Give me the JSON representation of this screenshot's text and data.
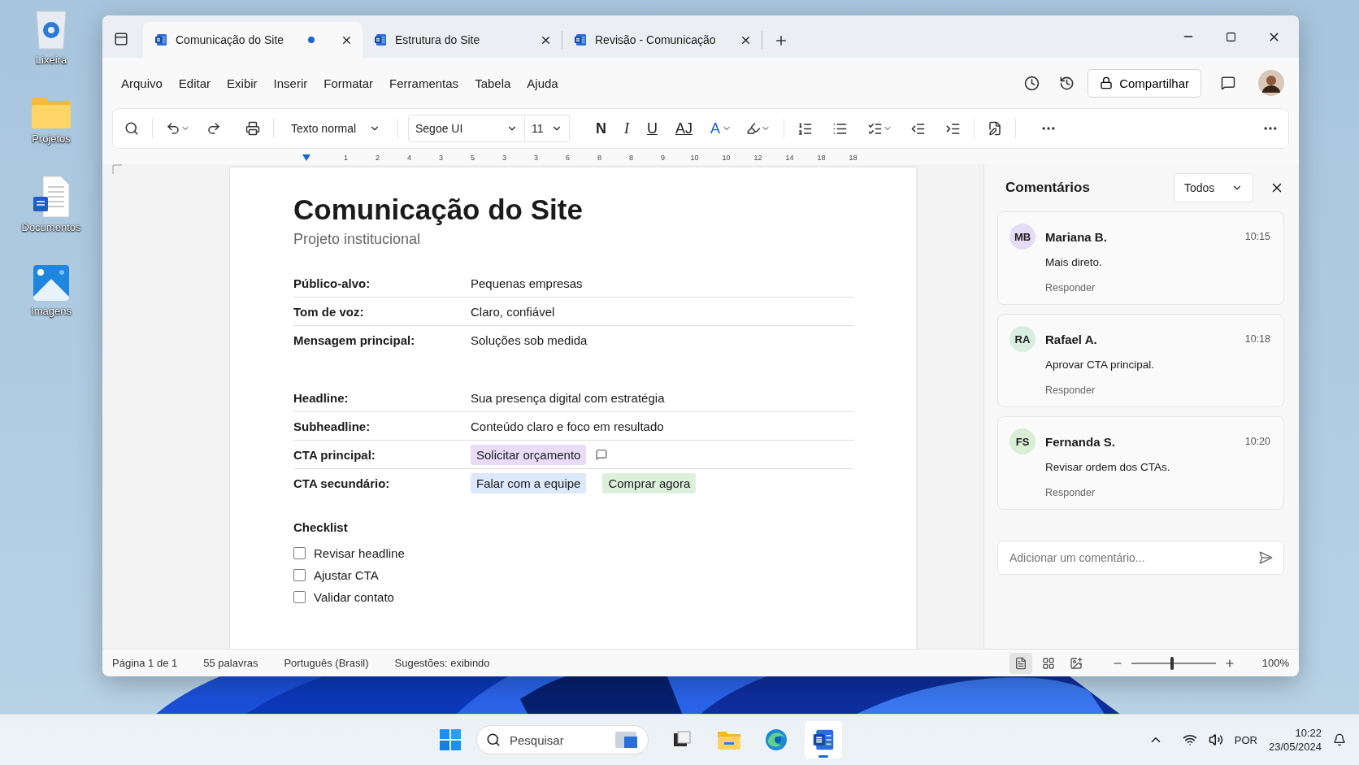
{
  "desktop_icons": [
    {
      "label": "Lixeira",
      "kind": "recycle"
    },
    {
      "label": "Projetos",
      "kind": "folder"
    },
    {
      "label": "Documentos",
      "kind": "document"
    },
    {
      "label": "Imagens",
      "kind": "images"
    }
  ],
  "tabs": [
    {
      "label": "Comunicação do Site",
      "selected": true,
      "unsaved": true
    },
    {
      "label": "Estrutura do Site",
      "selected": false,
      "unsaved": false
    },
    {
      "label": "Revisão - Comunicação",
      "selected": false,
      "unsaved": false
    }
  ],
  "menu": [
    "Arquivo",
    "Editar",
    "Exibir",
    "Inserir",
    "Formatar",
    "Ferramentas",
    "Tabela",
    "Ajuda"
  ],
  "share_button": "Compartilhar",
  "toolbar": {
    "style": "Texto normal",
    "font": "Segoe UI",
    "size": "11",
    "format_buttons": [
      "N",
      "I",
      "U",
      "AJ",
      "A"
    ]
  },
  "ruler": [
    "1",
    "2",
    "4",
    "3",
    "5",
    "3",
    "3",
    "6",
    "8",
    "8",
    "9",
    "10",
    "10",
    "12",
    "14",
    "18",
    "18"
  ],
  "document": {
    "title": "Comunicação do Site",
    "subtitle": "Projeto institucional",
    "field_groups": [
      [
        {
          "label": "Público-alvo:",
          "kind": "text",
          "value": "Pequenas empresas"
        },
        {
          "label": "Tom de voz:",
          "kind": "text",
          "value": "Claro, confiável"
        },
        {
          "label": "Mensagem principal:",
          "kind": "text",
          "value": "Soluções sob medida"
        }
      ],
      [
        {
          "label": "Headline:",
          "kind": "text",
          "value": "Sua presença digital com estratégia"
        },
        {
          "label": "Subheadline:",
          "kind": "text",
          "value": "Conteúdo claro e foco em resultado"
        },
        {
          "label": "CTA principal:",
          "kind": "chips",
          "commented": true,
          "chips": [
            {
              "text": "Solicitar orçamento",
              "color": "#e8dcf8"
            }
          ]
        },
        {
          "label": "CTA secundário:",
          "kind": "chips",
          "commented": false,
          "chips": [
            {
              "text": "Falar com a equipe",
              "color": "#dce8fb"
            },
            {
              "text": "Comprar agora",
              "color": "#dcf1dc"
            }
          ]
        }
      ]
    ],
    "checklist": {
      "title": "Checklist",
      "items": [
        {
          "label": "Revisar headline",
          "checked": false
        },
        {
          "label": "Ajustar CTA",
          "checked": false
        },
        {
          "label": "Validar contato",
          "checked": false
        }
      ]
    }
  },
  "comments": {
    "title": "Comentários",
    "filter": "Todos",
    "items": [
      {
        "initials": "MB",
        "color": "#e4ddf3",
        "author": "Mariana B.",
        "time": "10:15",
        "text": "Mais direto.",
        "reply": "Responder"
      },
      {
        "initials": "RA",
        "color": "#d9eee0",
        "author": "Rafael A.",
        "time": "10:18",
        "text": "Aprovar CTA principal.",
        "reply": "Responder"
      },
      {
        "initials": "FS",
        "color": "#d8efd4",
        "author": "Fernanda S.",
        "time": "10:20",
        "text": "Revisar ordem dos CTAs.",
        "reply": "Responder"
      }
    ],
    "placeholder": "Adicionar um comentário..."
  },
  "status_bar": {
    "items": [
      "Página 1 de 1",
      "55 palavras",
      "Português (Brasil)",
      "Sugestões: exibindo"
    ],
    "views": [
      {
        "kind": "print",
        "selected": true
      },
      {
        "kind": "web",
        "selected": false
      },
      {
        "kind": "focus",
        "selected": false
      }
    ],
    "zoom": {
      "level": 0.48,
      "reading": "100%"
    }
  },
  "taskbar": {
    "search_placeholder": "Pesquisar",
    "apps": [
      {
        "kind": "taskview",
        "active": false
      },
      {
        "kind": "explorer",
        "active": false
      },
      {
        "kind": "browser",
        "active": false
      },
      {
        "kind": "word",
        "active": true
      }
    ],
    "language": "POR",
    "time": "10:22",
    "date": "23/05/2024"
  }
}
